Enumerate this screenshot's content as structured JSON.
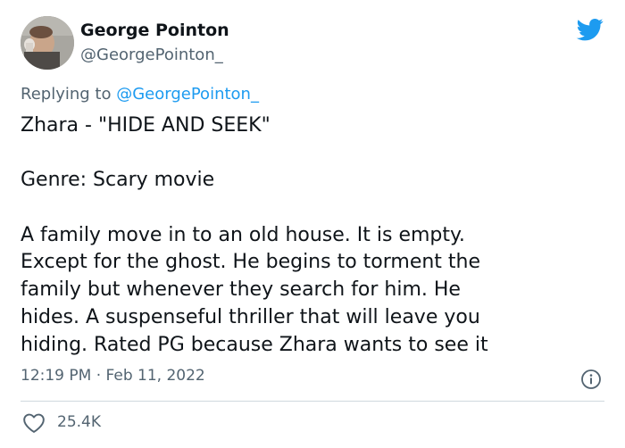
{
  "author": {
    "display_name": "George Pointon",
    "handle": "@GeorgePointon_"
  },
  "reply": {
    "prefix": "Replying to",
    "mention": "@GeorgePointon_"
  },
  "tweet": {
    "title_line": "Zhara - \"HIDE AND SEEK\"",
    "genre_line": "Genre: Scary movie",
    "body_lines": [
      "A family move in to an old house. It is empty.",
      "Except for the ghost. He begins to torment the",
      "family but whenever they search for him. He",
      "hides. A suspenseful thriller that will leave you",
      "hiding. Rated PG because Zhara wants to see it"
    ]
  },
  "meta": {
    "time": "12:19 PM",
    "separator": "·",
    "date": "Feb 11, 2022"
  },
  "engagement": {
    "likes": "25.4K"
  },
  "icons": {
    "brand": "twitter-bird-icon",
    "info": "info-icon",
    "like": "heart-icon"
  },
  "colors": {
    "brand_blue": "#1d9bf0",
    "secondary_text": "#536471",
    "primary_text": "#0f1419",
    "divider": "#cfd9de"
  }
}
